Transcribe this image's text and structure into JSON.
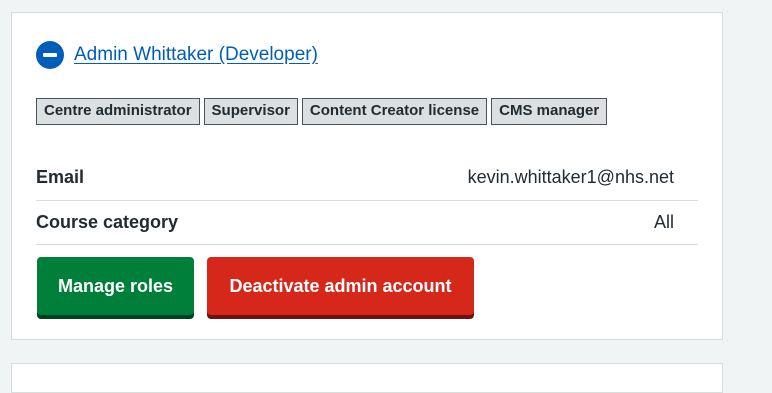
{
  "admin": {
    "name_link": "Admin Whittaker (Developer)",
    "toggle_icon": "minus-circle-icon"
  },
  "roles": [
    "Centre administrator",
    "Supervisor",
    "Content Creator license",
    "CMS manager"
  ],
  "details": {
    "email_label": "Email",
    "email_value": "kevin.whittaker1@nhs.net",
    "category_label": "Course category",
    "category_value": "All"
  },
  "actions": {
    "manage_roles": "Manage roles",
    "deactivate": "Deactivate admin account"
  },
  "colors": {
    "link": "#005eb8",
    "primary_button": "#007f3b",
    "warning_button": "#d5281b",
    "page_background": "#f0f4f5"
  }
}
